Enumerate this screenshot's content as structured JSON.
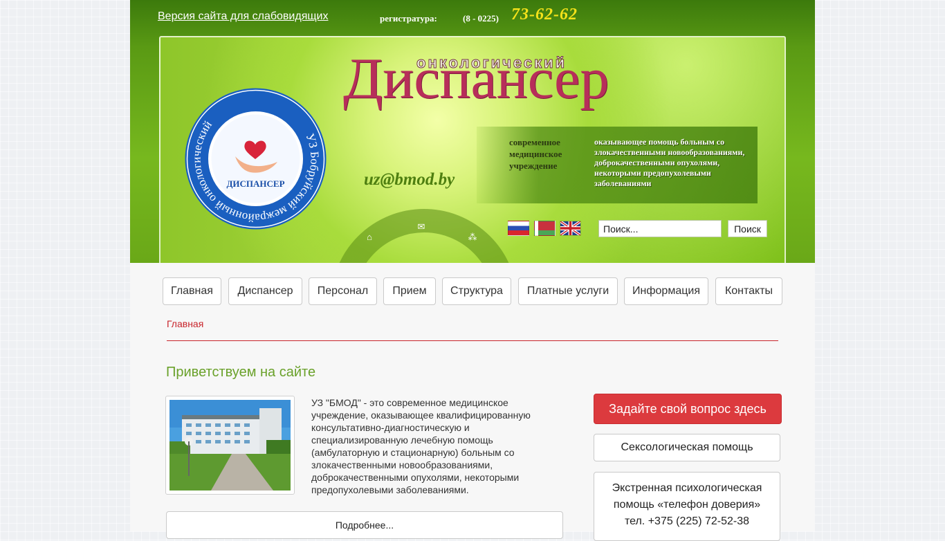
{
  "header": {
    "vision_link": "Версия сайта для слабовидящих",
    "registry_label": "регистратура:",
    "registry_code": "(8 - 0225)",
    "registry_number": "73-62-62",
    "title_small": "онкологический",
    "title_big": "Диспансер",
    "email": "uz@bmod.by",
    "desc_left": "современное медицинское учреждение",
    "desc_right": "оказывающее помощь больным со злокачественными новообразованиями, доброкачественными опухолями, некоторыми предопухолевыми заболеваниями",
    "seal_ring_text": "УЗ Бобруйский межрайонный онкологический",
    "seal_center_text": "ДИСПАНСЕР",
    "icons": [
      "home-icon",
      "mail-icon",
      "sitemap-icon"
    ],
    "flags": [
      "flag-ru",
      "flag-by",
      "flag-en"
    ]
  },
  "search": {
    "placeholder": "Поиск...",
    "button": "Поиск"
  },
  "nav": {
    "items": [
      "Главная",
      "Диспансер",
      "Персонал",
      "Прием",
      "Структура",
      "Платные услуги",
      "Информация",
      "Контакты"
    ]
  },
  "breadcrumb": "Главная",
  "main": {
    "heading": "Приветствуем на сайте",
    "intro": "УЗ \"БМОД\" - это современное медицинское учреждение, оказывающее квалифицированную консультативно-диагностическую и специализированную лечебную помощь (амбулаторную и стационарную) больным со злокачественными новообразованиями, доброкачественными опухолями, некоторыми предопухолевыми заболеваниями.",
    "more_button": "Подробнее..."
  },
  "sidebar": {
    "ask_button": "Задайте свой вопрос здесь",
    "sexology_button": "Сексологическая помощь",
    "hotline_line1": "Экстренная психологическая",
    "hotline_line2": "помощь «телефон доверия»",
    "hotline_phone": "тел. +375 (225) 72-52-38"
  },
  "colors": {
    "header_green": "#5a9a14",
    "title_crimson": "#b72e5a",
    "accent_red": "#dc3a3e",
    "heading_green": "#6aa12a",
    "registry_yellow": "#f5e21a"
  }
}
